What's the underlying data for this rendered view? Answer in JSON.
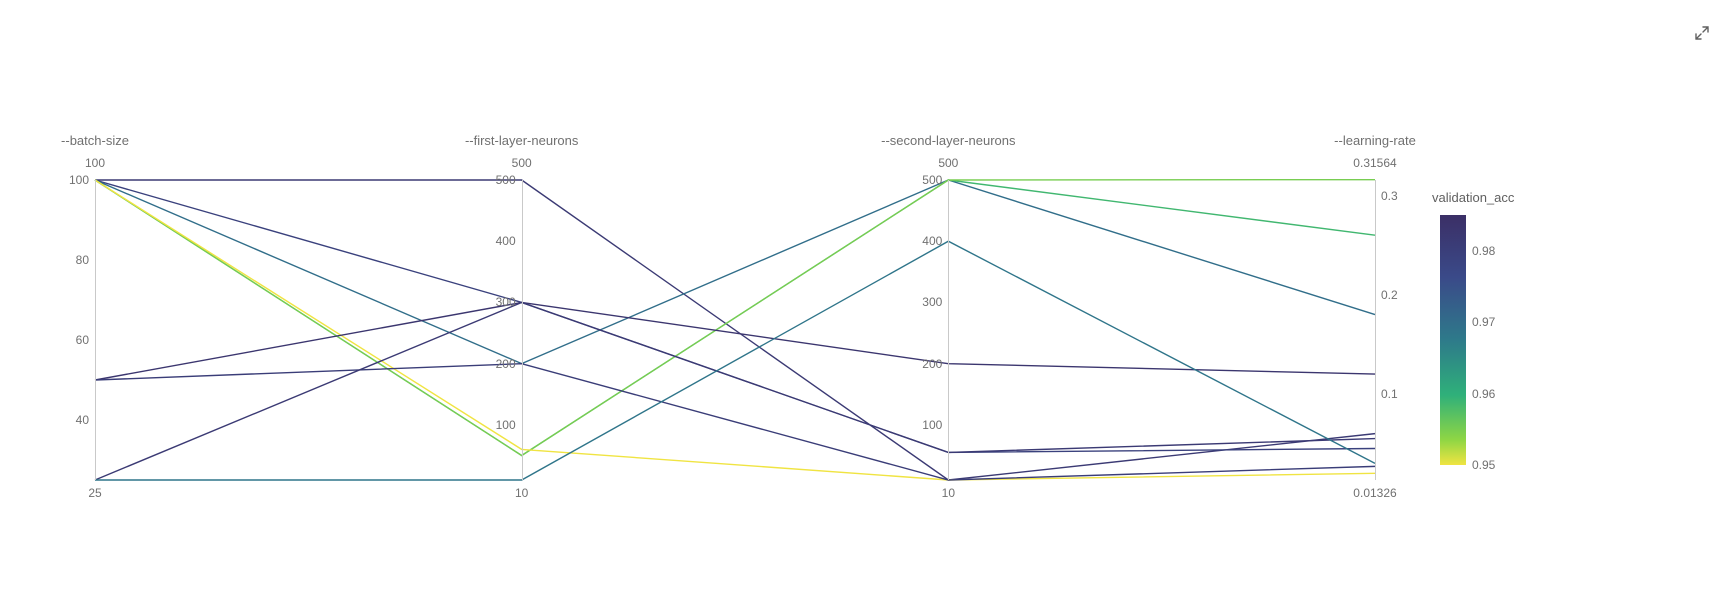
{
  "expand_button": {
    "name": "expand-icon"
  },
  "colorbar": {
    "title": "validation_acc",
    "ticks": [
      {
        "value": 0.98,
        "label": "0.98"
      },
      {
        "value": 0.97,
        "label": "0.97"
      },
      {
        "value": 0.96,
        "label": "0.96"
      },
      {
        "value": 0.95,
        "label": "0.95"
      }
    ],
    "domain": [
      0.95,
      0.985
    ]
  },
  "chart_data": {
    "type": "parallel-coordinates",
    "color_metric": "validation_acc",
    "axes": [
      {
        "id": "batch_size",
        "label": "--batch-size",
        "range": [
          25,
          100
        ],
        "range_labels": {
          "top": "100",
          "bottom": "25"
        },
        "ticks": [
          {
            "value": 100,
            "label": "100"
          },
          {
            "value": 80,
            "label": "80"
          },
          {
            "value": 60,
            "label": "60"
          },
          {
            "value": 40,
            "label": "40"
          }
        ],
        "tick_side": "left"
      },
      {
        "id": "first_layer_neurons",
        "label": "--first-layer-neurons",
        "range": [
          10,
          500
        ],
        "range_labels": {
          "top": "500",
          "bottom": "10"
        },
        "ticks": [
          {
            "value": 500,
            "label": "500"
          },
          {
            "value": 400,
            "label": "400"
          },
          {
            "value": 300,
            "label": "300"
          },
          {
            "value": 200,
            "label": "200"
          },
          {
            "value": 100,
            "label": "100"
          }
        ],
        "tick_side": "left"
      },
      {
        "id": "second_layer_neurons",
        "label": "--second-layer-neurons",
        "range": [
          10,
          500
        ],
        "range_labels": {
          "top": "500",
          "bottom": "10"
        },
        "ticks": [
          {
            "value": 500,
            "label": "500"
          },
          {
            "value": 400,
            "label": "400"
          },
          {
            "value": 300,
            "label": "300"
          },
          {
            "value": 200,
            "label": "200"
          },
          {
            "value": 100,
            "label": "100"
          }
        ],
        "tick_side": "left"
      },
      {
        "id": "learning_rate",
        "label": "--learning-rate",
        "range": [
          0.01326,
          0.31564
        ],
        "range_labels": {
          "top": "0.31564",
          "bottom": "0.01326"
        },
        "ticks": [
          {
            "value": 0.3,
            "label": "0.3"
          },
          {
            "value": 0.2,
            "label": "0.2"
          },
          {
            "value": 0.1,
            "label": "0.1"
          }
        ],
        "tick_side": "right"
      }
    ],
    "runs": [
      {
        "batch_size": 100,
        "first_layer_neurons": 500,
        "second_layer_neurons": 10,
        "learning_rate": 0.06,
        "validation_acc": 0.982
      },
      {
        "batch_size": 100,
        "first_layer_neurons": 300,
        "second_layer_neurons": 55,
        "learning_rate": 0.045,
        "validation_acc": 0.98
      },
      {
        "batch_size": 100,
        "first_layer_neurons": 200,
        "second_layer_neurons": 500,
        "learning_rate": 0.18,
        "validation_acc": 0.972
      },
      {
        "batch_size": 100,
        "first_layer_neurons": 50,
        "second_layer_neurons": 500,
        "learning_rate": 0.26,
        "validation_acc": 0.962
      },
      {
        "batch_size": 100,
        "first_layer_neurons": 50,
        "second_layer_neurons": 500,
        "learning_rate": 0.316,
        "validation_acc": 0.958
      },
      {
        "batch_size": 100,
        "first_layer_neurons": 60,
        "second_layer_neurons": 10,
        "learning_rate": 0.02,
        "validation_acc": 0.95
      },
      {
        "batch_size": 50,
        "first_layer_neurons": 300,
        "second_layer_neurons": 200,
        "learning_rate": 0.12,
        "validation_acc": 0.983
      },
      {
        "batch_size": 50,
        "first_layer_neurons": 200,
        "second_layer_neurons": 10,
        "learning_rate": 0.027,
        "validation_acc": 0.981
      },
      {
        "batch_size": 25,
        "first_layer_neurons": 300,
        "second_layer_neurons": 55,
        "learning_rate": 0.055,
        "validation_acc": 0.982
      },
      {
        "batch_size": 25,
        "first_layer_neurons": 10,
        "second_layer_neurons": 400,
        "learning_rate": 0.03,
        "validation_acc": 0.971
      }
    ]
  }
}
